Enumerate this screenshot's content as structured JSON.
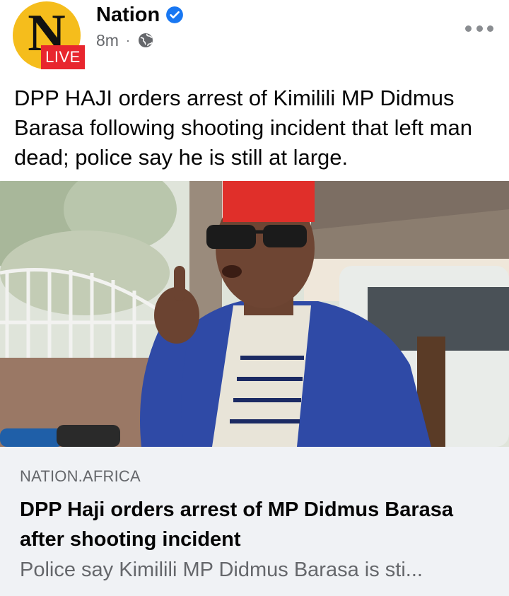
{
  "post": {
    "page_name": "Nation",
    "verified": true,
    "time": "8m",
    "separator": "·",
    "privacy_icon": "globe-icon",
    "avatar": {
      "letter": "N",
      "badge": "LIVE",
      "bg_color": "#f5bd1c",
      "badge_color": "#e8262e"
    },
    "menu_icon": "more-horizontal-icon",
    "text": "DPP HAJI orders arrest of Kimilili MP Didmus Barasa following shooting incident that left man dead; police say he is still at large."
  },
  "link_preview": {
    "domain": "NATION.AFRICA",
    "title": "DPP Haji orders arrest of MP Didmus Barasa after shooting incident",
    "description": "Police say Kimilili MP Didmus Barasa is sti...",
    "bg_color": "#f0f2f5"
  },
  "colors": {
    "verified_badge": "#1877f2",
    "secondary_text": "#65676b"
  }
}
